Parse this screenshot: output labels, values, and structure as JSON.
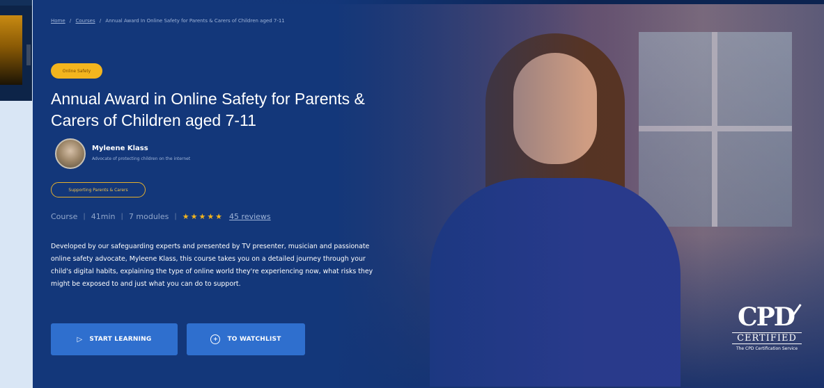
{
  "breadcrumb": {
    "home": "Home",
    "courses": "Courses",
    "current": "Annual Award In Online Safety for Parents & Carers of Children aged 7-11",
    "separator": "/"
  },
  "badge": {
    "label": "Online Safety"
  },
  "course": {
    "title": "Annual Award in Online Safety for Parents & Carers of Children aged 7-11",
    "presenter_name": "Myleene Klass",
    "presenter_role": "Advocate of protecting children on the internet",
    "category_tag": "Supporting Parents & Carers"
  },
  "meta": {
    "type": "Course",
    "duration": "41min",
    "modules": "7 modules",
    "rating_stars": "★★★★★",
    "rating_value": 5,
    "reviews": "45 reviews"
  },
  "description": "Developed by our safeguarding experts and presented by TV presenter, musician and passionate online safety advocate, Myleene Klass, this course takes you on a detailed journey through your child's digital habits, explaining the type of online world they're experiencing now, what risks they might be exposed to and just what you can do to support.",
  "actions": {
    "start_label": "START LEARNING",
    "watchlist_label": "TO WATCHLIST",
    "start_icon": "play-icon",
    "watchlist_icon": "plus-circle-icon"
  },
  "cpd": {
    "big": "CPD",
    "mid": "CERTIFIED",
    "small": "The CPD Certification Service"
  },
  "colors": {
    "hero_bg": "#13377a",
    "accent_yellow": "#f3b51e",
    "button_blue": "#2f6fce"
  }
}
